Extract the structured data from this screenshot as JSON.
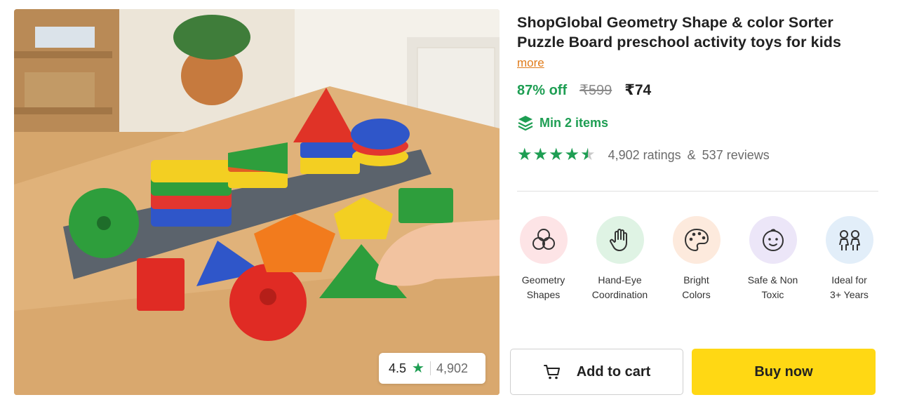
{
  "product": {
    "title": "ShopGlobal Geometry Shape & color Sorter Puzzle Board preschool activity toys for kids",
    "more_label": "more",
    "discount": "87% off",
    "mrp": "₹599",
    "price": "₹74",
    "offer": "Min 2 items",
    "rating_value": 4.5,
    "ratings_text": "4,902 ratings",
    "amp": "&",
    "reviews_text": "537 reviews"
  },
  "image_badge": {
    "score": "4.5",
    "star": "★",
    "count": "4,902"
  },
  "features": [
    {
      "label": "Geometry\nShapes",
      "icon": "circles-icon",
      "bg": "#fde4e6"
    },
    {
      "label": "Hand-Eye\nCoordination",
      "icon": "hand-icon",
      "bg": "#dff3e4"
    },
    {
      "label": "Bright\nColors",
      "icon": "palette-icon",
      "bg": "#fdeadd"
    },
    {
      "label": "Safe & Non\nToxic",
      "icon": "baby-face-icon",
      "bg": "#ece6f8"
    },
    {
      "label": "Ideal for\n3+ Years",
      "icon": "kids-icon",
      "bg": "#e2eef9"
    }
  ],
  "actions": {
    "add_to_cart": "Add to cart",
    "buy_now": "Buy now"
  },
  "colors": {
    "green": "#1e9e53",
    "orange_link": "#e07b1a",
    "buy_button": "#ffd814"
  }
}
